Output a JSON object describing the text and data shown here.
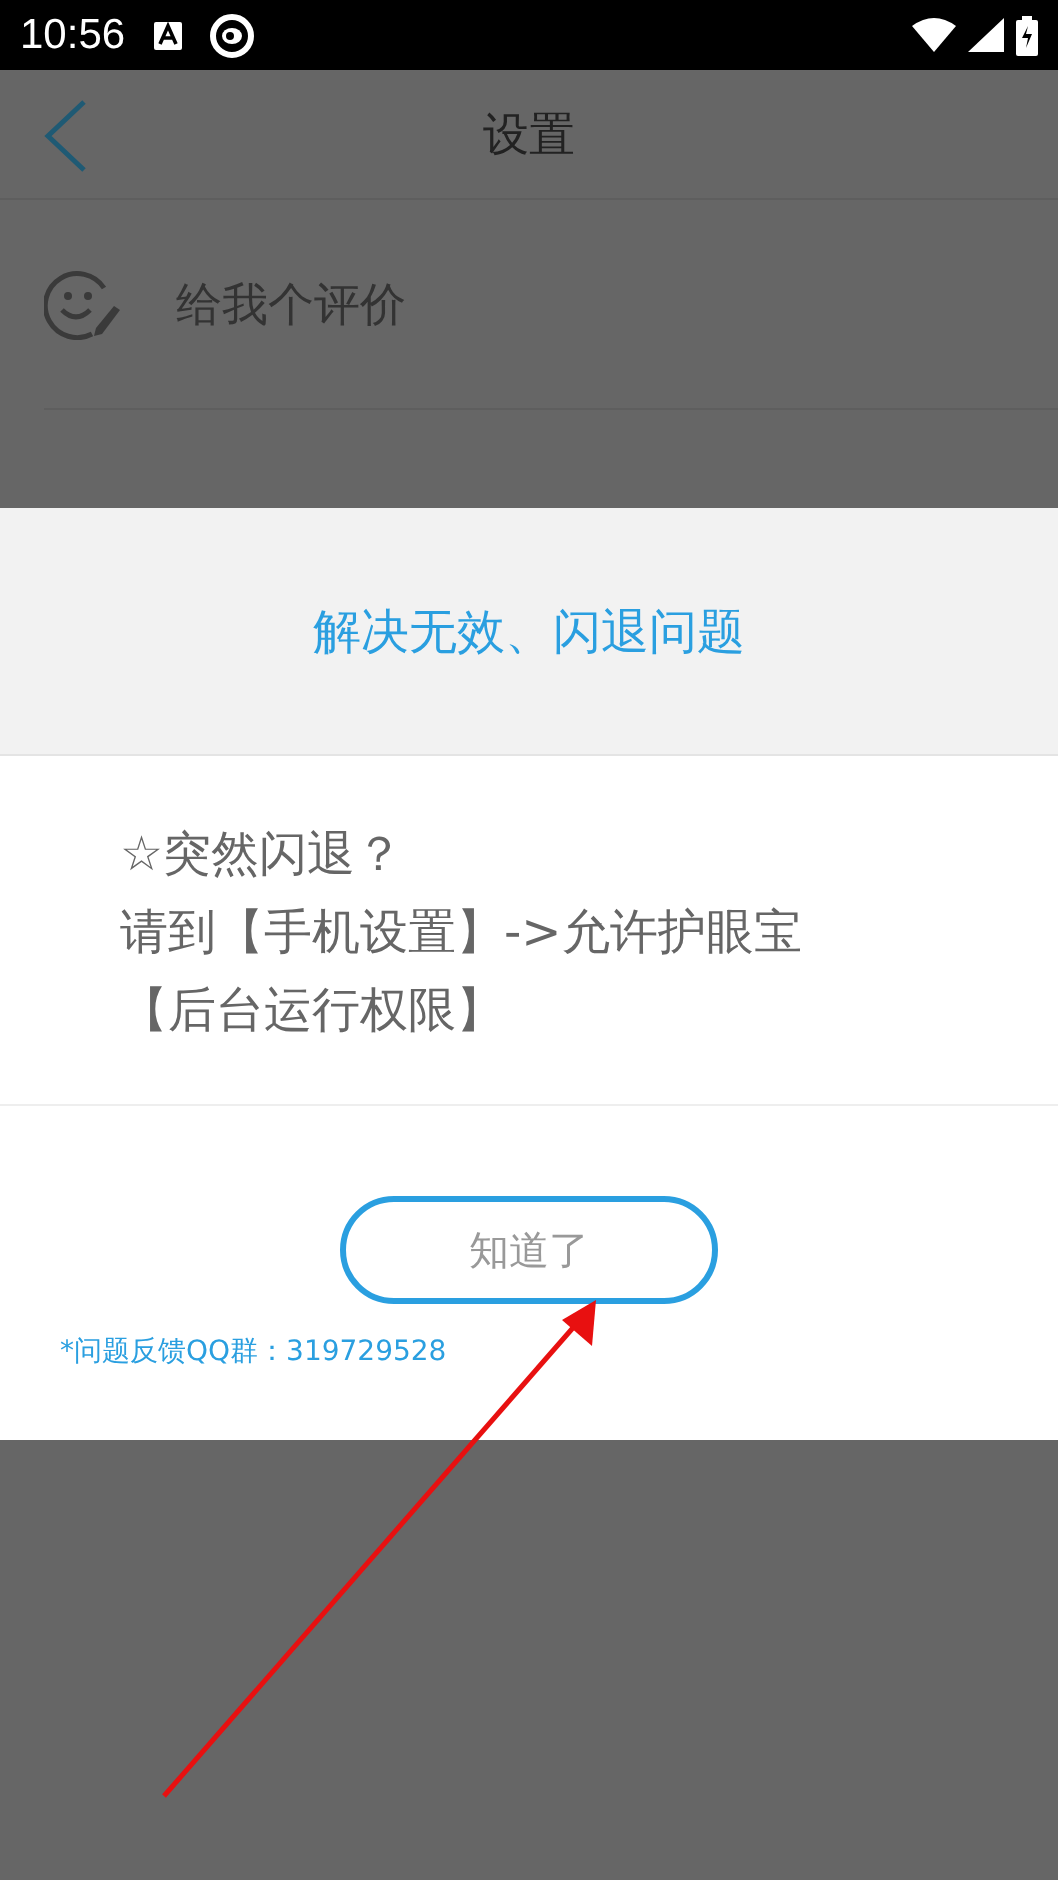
{
  "status_bar": {
    "time": "10:56"
  },
  "header": {
    "title": "设置"
  },
  "settings_items": [
    {
      "label": "给我个评价"
    }
  ],
  "dialog": {
    "title": "解决无效、闪退问题",
    "message_lines": [
      "☆突然闪退？",
      "请到【手机设置】->允许护眼宝",
      "【后台运行权限】"
    ],
    "button": "知道了",
    "footnote": "*问题反馈QQ群：319729528"
  }
}
